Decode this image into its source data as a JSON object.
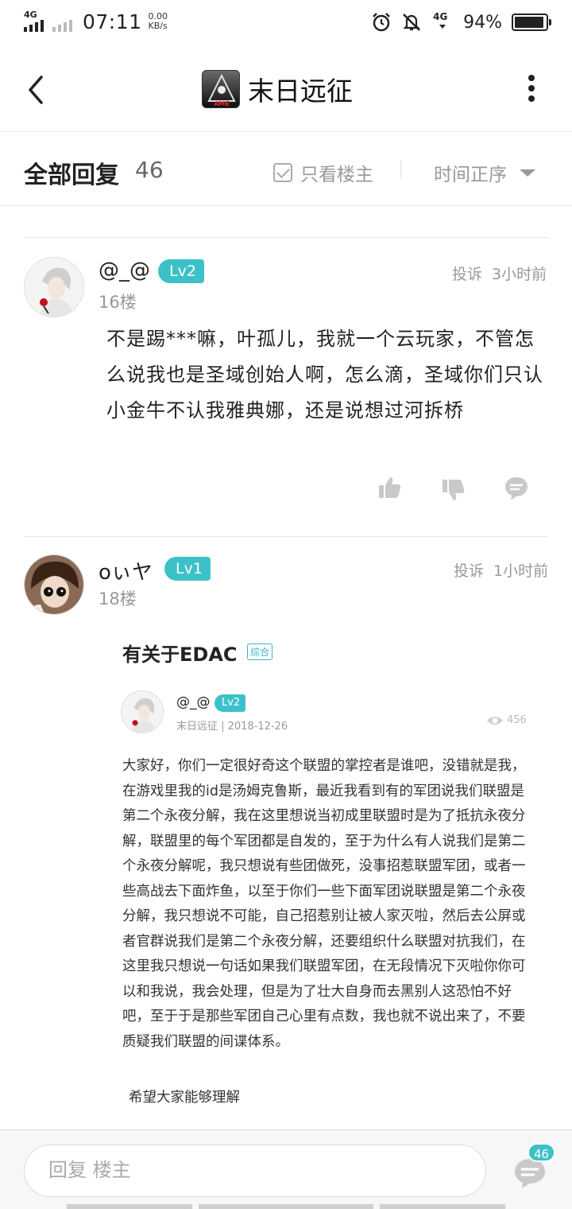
{
  "status_bar": {
    "network_left": "4G",
    "time": "07:11",
    "speed_value": "0.00",
    "speed_unit": "KB/s",
    "network_right": "4G",
    "battery_percent": "94%",
    "battery_level": 0.94,
    "icons": [
      "alarm-icon",
      "mute-icon"
    ]
  },
  "header": {
    "title": "末日远征",
    "logo_text": "AME"
  },
  "filter_bar": {
    "all_replies_label": "全部回复",
    "reply_count": "46",
    "op_only_label": "只看楼主",
    "sort_label": "时间正序"
  },
  "comments": [
    {
      "username": "@_@",
      "level": "Lv2",
      "floor": "16楼",
      "report_label": "投诉",
      "time": "3小时前",
      "text": "不是踢***嘛，叶孤儿，我就一个云玩家，不管怎么说我也是圣域创始人啊，怎么滴，圣域你们只认小金牛不认我雅典娜，还是说想过河拆桥"
    },
    {
      "username": "oぃヤ",
      "level": "Lv1",
      "floor": "18楼",
      "report_label": "投诉",
      "time": "1小时前",
      "quoted_post": {
        "title": "有关于EDAC",
        "tag": "综合",
        "author": "@_@",
        "author_level": "Lv2",
        "meta": "末日远征 | 2018-12-26",
        "views": "456",
        "body": "大家好，你们一定很好奇这个联盟的掌控者是谁吧，没错就是我，在游戏里我的id是汤姆克鲁斯，最近我看到有的军团说我们联盟是第二个永夜分解，我在这里想说当初成里联盟时是为了抵抗永夜分解，联盟里的每个军团都是自发的，至于为什么有人说我们是第二个永夜分解呢，我只想说有些团做死，没事招惹联盟军团，或者一些高战去下面炸鱼，以至于你们一些下面军团说联盟是第二个永夜分解，我只想说不可能，自己招惹别让被人家灭啦，然后去公屏或者官群说我们是第二个永夜分解，还要组织什么联盟对抗我们，在这里我只想说一句话如果我们联盟军团，在无段情况下灭啦你你可以和我说，我会处理，但是为了壮大自身而去黑别人这恐怕不好吧，至于于是那些军团自己心里有点数，我也就不说出来了，不要质疑我们联盟的间谍体系。",
        "footer": "希望大家能够理解"
      }
    }
  ],
  "bottom_bar": {
    "reply_placeholder": "回复  楼主",
    "badge_count": "46"
  }
}
